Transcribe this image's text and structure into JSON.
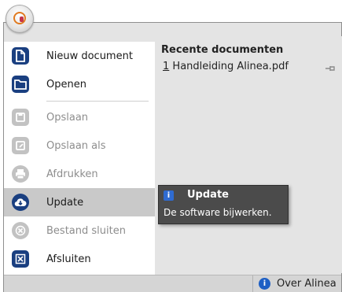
{
  "menu": {
    "new": "Nieuw document",
    "open": "Openen",
    "save": "Opslaan",
    "save_as": "Opslaan als",
    "print": "Afdrukken",
    "update": "Update",
    "close_file": "Bestand sluiten",
    "exit": "Afsluiten"
  },
  "recent": {
    "title": "Recente documenten",
    "items": [
      {
        "num": "1",
        "name": "Handleiding Alinea.pdf"
      }
    ]
  },
  "tooltip": {
    "title": "Update",
    "description": "De software bijwerken."
  },
  "statusbar": {
    "about_label": "Over Alinea"
  },
  "colors": {
    "accent": "#1a3f80",
    "info": "#1e5fc4"
  }
}
